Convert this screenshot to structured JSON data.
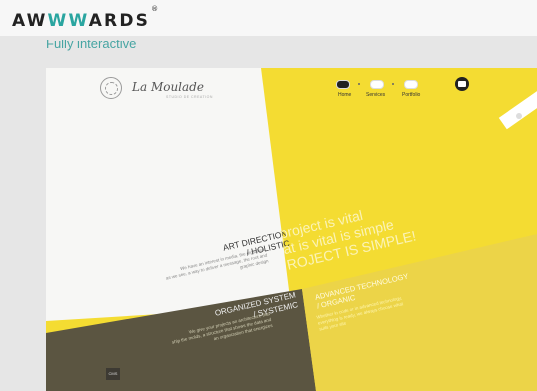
{
  "header": {
    "logo_prefix": "AW",
    "logo_mid": "WW",
    "logo_suffix": "ARDS",
    "logo_mark": "®"
  },
  "page": {
    "partial_title": "Fully interactive"
  },
  "site": {
    "brand_name": "La Moulade",
    "brand_tagline": "STUDIO DE CREATION",
    "nav": [
      "Home",
      "Services",
      "Portfolio"
    ],
    "sections": {
      "art_title_line1": "ART DIRECTION",
      "art_title_line2": "/ HOLISTIC",
      "art_text_line1": "We have an interest in media, the digital era",
      "art_text_line2": "as we see, a way to deliver a message, the root and",
      "art_text_line3": "graphic design",
      "slogan_line1": "project is vital",
      "slogan_line2": "at is vital is simple",
      "slogan_line3": "ROJECT IS SIMPLE!",
      "org_title_line1": "ORGANIZED SYSTEM",
      "org_title_line2": "/ SYSTEMIC",
      "org_text_line1": "We give your projects an architecture that",
      "org_text_line2": "ship the molds, a structure that shows the data and",
      "org_text_line3": "an organization that energizes",
      "adv_title_line1": "ADVANCED TECHNOLOGY",
      "adv_title_line2": "/ ORGANIC",
      "adv_text_line1": "Whether in code or in advanced technology,",
      "adv_text_line2": "everything is ready, we always choose what",
      "adv_text_line3": "suits your site",
      "cms_label": "CMS"
    }
  },
  "colors": {
    "yellow": "#f4dc32",
    "olive": "#5b5541",
    "teal": "#2aa5a0"
  }
}
